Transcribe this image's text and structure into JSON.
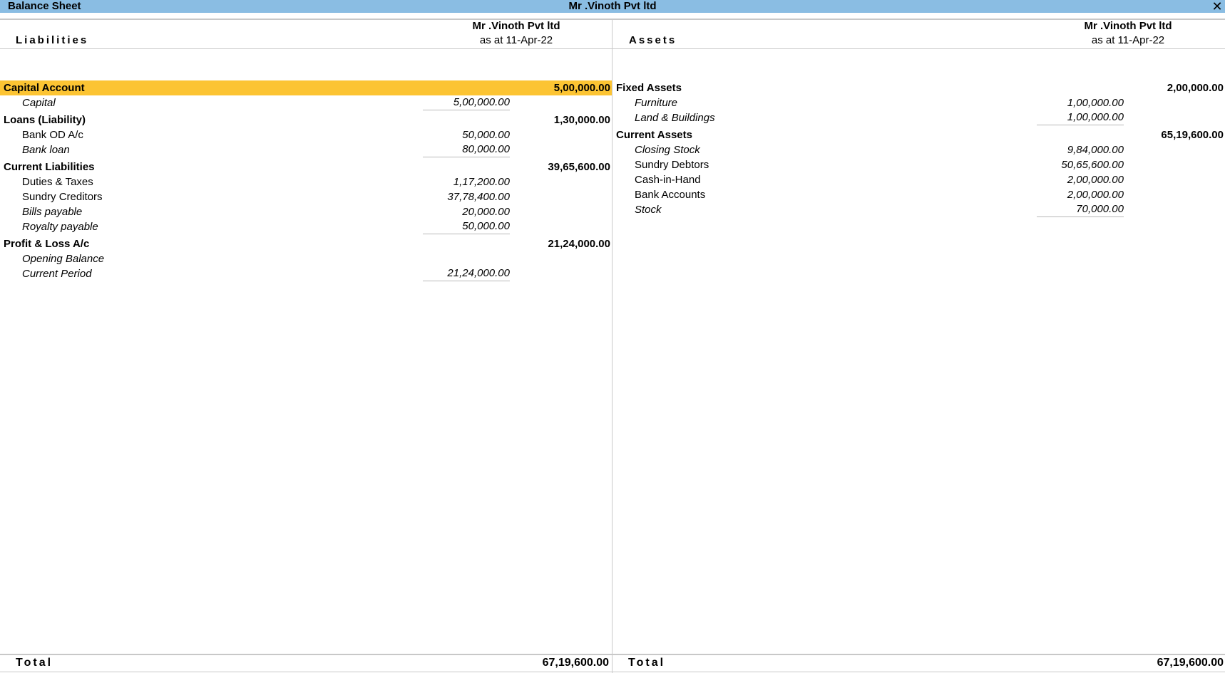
{
  "window": {
    "title": "Balance Sheet",
    "company": "Mr .Vinoth  Pvt ltd",
    "close_icon": "close-x-icon"
  },
  "liabilities": {
    "heading": "Liabilities",
    "company": "Mr .Vinoth  Pvt ltd",
    "date": "as at 11-Apr-22",
    "groups": [
      {
        "name": "Capital Account",
        "amount": "5,00,000.00",
        "selected": true,
        "items": [
          {
            "name": "Capital",
            "amount": "5,00,000.00",
            "italic": true
          }
        ]
      },
      {
        "name": "Loans (Liability)",
        "amount": "1,30,000.00",
        "items": [
          {
            "name": "Bank OD A/c",
            "amount": "50,000.00",
            "italic": false
          },
          {
            "name": "Bank loan",
            "amount": "80,000.00",
            "italic": true
          }
        ]
      },
      {
        "name": "Current Liabilities",
        "amount": "39,65,600.00",
        "items": [
          {
            "name": "Duties & Taxes",
            "amount": "1,17,200.00",
            "italic": false
          },
          {
            "name": "Sundry Creditors",
            "amount": "37,78,400.00",
            "italic": false
          },
          {
            "name": "Bills payable",
            "amount": "20,000.00",
            "italic": true
          },
          {
            "name": "Royalty payable",
            "amount": "50,000.00",
            "italic": true
          }
        ]
      },
      {
        "name": "Profit & Loss A/c",
        "amount": "21,24,000.00",
        "items": [
          {
            "name": "Opening Balance",
            "amount": "",
            "italic": true
          },
          {
            "name": "Current Period",
            "amount": "21,24,000.00",
            "italic": true
          }
        ]
      }
    ],
    "total_label": "Total",
    "total": "67,19,600.00"
  },
  "assets": {
    "heading": "Assets",
    "company": "Mr .Vinoth  Pvt ltd",
    "date": "as at 11-Apr-22",
    "groups": [
      {
        "name": "Fixed Assets",
        "amount": "2,00,000.00",
        "items": [
          {
            "name": "Furniture",
            "amount": "1,00,000.00",
            "italic": true
          },
          {
            "name": "Land & Buildings",
            "amount": "1,00,000.00",
            "italic": true
          }
        ]
      },
      {
        "name": "Current Assets",
        "amount": "65,19,600.00",
        "items": [
          {
            "name": "Closing Stock",
            "amount": "9,84,000.00",
            "italic": true
          },
          {
            "name": "Sundry Debtors",
            "amount": "50,65,600.00",
            "italic": false
          },
          {
            "name": "Cash-in-Hand",
            "amount": "2,00,000.00",
            "italic": false
          },
          {
            "name": "Bank Accounts",
            "amount": "2,00,000.00",
            "italic": false
          },
          {
            "name": "Stock",
            "amount": "70,000.00",
            "italic": true
          }
        ]
      }
    ],
    "total_label": "Total",
    "total": "67,19,600.00"
  },
  "colors": {
    "titlebar": "#8abde3",
    "selected_row": "#fcc433"
  }
}
